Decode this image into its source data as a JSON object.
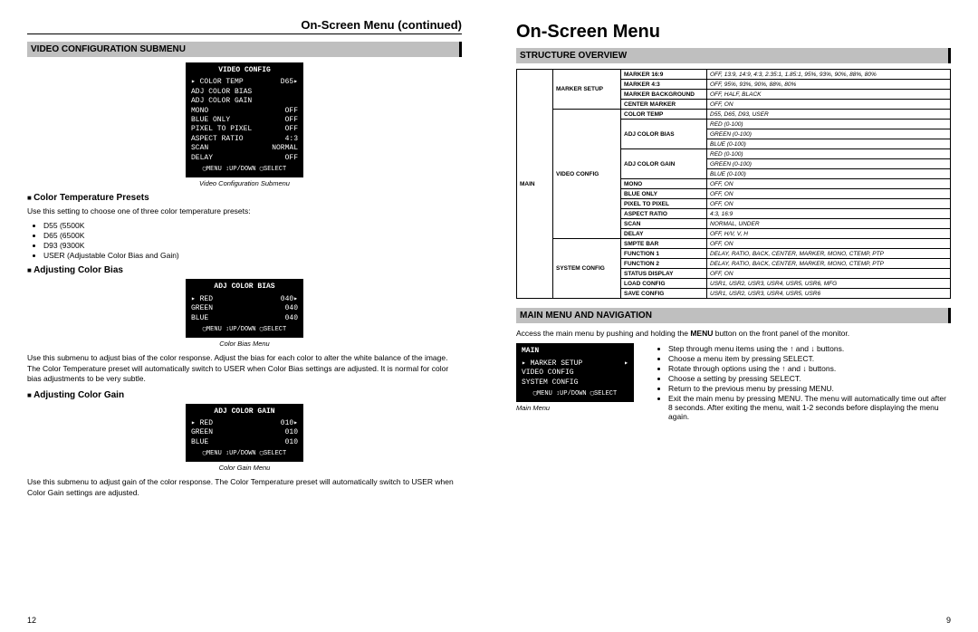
{
  "left": {
    "running_head": "On-Screen Menu (continued)",
    "section": "VIDEO CONFIGURATION SUBMENU",
    "osd1": {
      "title": "VIDEO CONFIG",
      "rows": [
        [
          "▸ COLOR TEMP",
          "D65▸"
        ],
        [
          "  ADJ COLOR BIAS",
          ""
        ],
        [
          "  ADJ COLOR GAIN",
          ""
        ],
        [
          "  MONO",
          "OFF"
        ],
        [
          "  BLUE ONLY",
          "OFF"
        ],
        [
          "  PIXEL TO PIXEL",
          "OFF"
        ],
        [
          "  ASPECT RATIO",
          "4:3"
        ],
        [
          "  SCAN",
          "NORMAL"
        ],
        [
          "  DELAY",
          "OFF"
        ]
      ],
      "footer": "▢MENU ↕UP/DOWN ▢SELECT",
      "caption": "Video Configuration Submenu"
    },
    "presets": {
      "head": "Color Temperature Presets",
      "intro": "Use this setting to choose one of three color temperature presets:",
      "items": [
        "D55 (5500K",
        "D65 (6500K",
        "D93 (9300K",
        "USER (Adjustable Color Bias and Gain)"
      ]
    },
    "bias": {
      "head": "Adjusting Color Bias",
      "osd": {
        "title": "ADJ COLOR BIAS",
        "rows": [
          [
            "▸ RED",
            "040▸"
          ],
          [
            "  GREEN",
            "040"
          ],
          [
            "  BLUE",
            "040"
          ]
        ],
        "footer": "▢MENU ↕UP/DOWN ▢SELECT",
        "caption": "Color Bias Menu"
      },
      "text": "Use this submenu to adjust bias of the color response. Adjust the bias for each color to alter the white balance of the image. The Color Temperature preset will automatically switch to USER when Color Bias settings are adjusted. It is normal for color bias adjustments to be very subtle."
    },
    "gain": {
      "head": "Adjusting Color Gain",
      "osd": {
        "title": "ADJ COLOR GAIN",
        "rows": [
          [
            "▸ RED",
            "010▸"
          ],
          [
            "  GREEN",
            "010"
          ],
          [
            "  BLUE",
            "010"
          ]
        ],
        "footer": "▢MENU ↕UP/DOWN ▢SELECT",
        "caption": "Color Gain Menu"
      },
      "text": "Use this submenu to adjust gain of the color response. The Color Temperature preset will automatically switch to USER when Color Gain settings are adjusted."
    },
    "page_num": "12"
  },
  "right": {
    "title": "On-Screen Menu",
    "section1": "STRUCTURE OVERVIEW",
    "table": [
      {
        "c": "MAIN",
        "rs": 23,
        "g": "MARKER SETUP",
        "grs": 4,
        "k": "MARKER 16:9",
        "v": "OFF, 13:9, 14:9, 4:3, 2.35:1, 1.85:1, 95%, 93%, 90%, 88%, 80%"
      },
      {
        "k": "MARKER 4:3",
        "v": "OFF, 95%, 93%, 90%, 88%, 80%"
      },
      {
        "k": "MARKER BACKGROUND",
        "v": "OFF, HALF, BLACK"
      },
      {
        "k": "CENTER MARKER",
        "v": "OFF, ON"
      },
      {
        "g": "VIDEO CONFIG",
        "grs": 13,
        "k": "COLOR TEMP",
        "v": "D55, D65, D93, USER"
      },
      {
        "k": "ADJ COLOR BIAS",
        "ks": 3,
        "v": "RED (0-100)"
      },
      {
        "v": "GREEN (0-100)"
      },
      {
        "v": "BLUE (0-100)"
      },
      {
        "k": "ADJ COLOR GAIN",
        "ks": 3,
        "v": "RED (0-100)"
      },
      {
        "v": "GREEN (0-100)"
      },
      {
        "v": "BLUE (0-100)"
      },
      {
        "k": "MONO",
        "v": "OFF, ON"
      },
      {
        "k": "BLUE ONLY",
        "v": "OFF, ON"
      },
      {
        "k": "PIXEL TO PIXEL",
        "v": "OFF, ON"
      },
      {
        "k": "ASPECT RATIO",
        "v": "4:3, 16:9"
      },
      {
        "k": "SCAN",
        "v": "NORMAL, UNDER"
      },
      {
        "k": "DELAY",
        "v": "OFF, H/V, V, H"
      },
      {
        "g": "SYSTEM CONFIG",
        "grs": 6,
        "k": "SMPTE BAR",
        "v": "OFF, ON"
      },
      {
        "k": "FUNCTION 1",
        "v": "DELAY, RATIO, BACK, CENTER, MARKER, MONO, CTEMP, PTP"
      },
      {
        "k": "FUNCTION 2",
        "v": "DELAY, RATIO, BACK, CENTER, MARKER, MONO, CTEMP, PTP"
      },
      {
        "k": "STATUS DISPLAY",
        "v": "OFF, ON"
      },
      {
        "k": "LOAD CONFIG",
        "v": "USR1, USR2, USR3, USR4, USR5, USR6, MFG"
      },
      {
        "k": "SAVE CONFIG",
        "v": "USR1, USR2, USR3, USR4, USR5, USR6"
      }
    ],
    "section2": "MAIN MENU AND NAVIGATION",
    "nav_intro_a": "Access the main menu by pushing and holding the ",
    "nav_intro_b": "MENU",
    "nav_intro_c": " button on the front panel of the monitor.",
    "main_osd": {
      "title": "MAIN",
      "rows": [
        [
          "▸ MARKER SETUP",
          "▸"
        ],
        [
          "  VIDEO CONFIG",
          ""
        ],
        [
          "  SYSTEM CONFIG",
          ""
        ]
      ],
      "footer": "▢MENU ↕UP/DOWN ▢SELECT",
      "caption": "Main Menu"
    },
    "nav_bullets": [
      "Step through menu items using the ↑ and ↓ buttons.",
      "Choose a menu item by pressing SELECT.",
      "Rotate through options using the ↑ and ↓ buttons.",
      "Choose a setting by pressing SELECT.",
      "Return to the previous menu by pressing MENU.",
      "Exit the main menu by pressing MENU. The menu will automatically time out after 8 seconds. After exiting the menu, wait 1-2 seconds before displaying the menu again."
    ],
    "page_num": "9"
  }
}
